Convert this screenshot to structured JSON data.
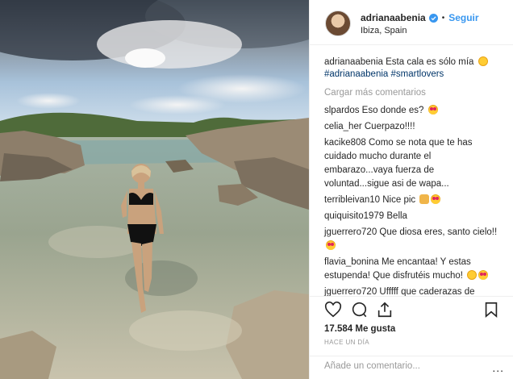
{
  "header": {
    "username": "adrianaabenia",
    "separator": "•",
    "follow_label": "Seguir",
    "location": "Ibiza, Spain"
  },
  "caption": {
    "username": "adrianaabenia",
    "text": "Esta cala es sólo mía",
    "tags": "#adrianaabenia #smartlovers"
  },
  "load_more": "Cargar más comentarios",
  "comments": [
    {
      "user": "slpardos",
      "text": "Eso donde es?"
    },
    {
      "user": "celia_her",
      "text": "Cuerpazo!!!!"
    },
    {
      "user": "kacike808",
      "text": "Como se nota que te has cuidado mucho durante el embarazo...vaya fuerza de voluntad...sigue asi de wapa..."
    },
    {
      "user": "terribleivan10",
      "text": "Nice pic"
    },
    {
      "user": "quiquisito1979",
      "text": "Bella"
    },
    {
      "user": "jguerrero720",
      "text": "Que diosa eres, santo cielo!!"
    },
    {
      "user": "flavia_bonina",
      "text": "Me encantaa! Y estas estupenda! Que disfrutéis mucho!"
    },
    {
      "user": "jguerrero720",
      "text": "Ufffff que caderazas de locura se te han puesto"
    }
  ],
  "likes": "17.584 Me gusta",
  "timestamp": "HACE UN DÍA",
  "add_comment_placeholder": "Añade un comentario...",
  "more_label": "...",
  "icons": [
    "heart-icon",
    "comment-icon",
    "share-icon",
    "bookmark-icon",
    "verified-icon",
    "options-icon"
  ],
  "colors": {
    "link": "#3897f0",
    "hashtag": "#003569",
    "muted": "#999999",
    "border": "#efefef"
  }
}
